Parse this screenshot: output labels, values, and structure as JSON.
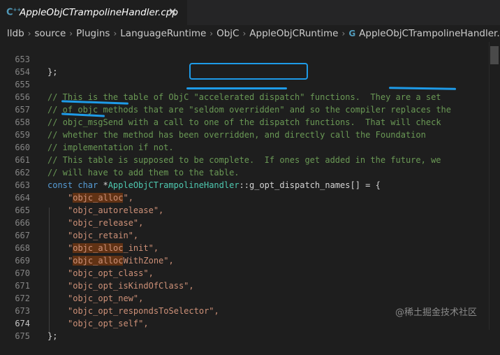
{
  "tab": {
    "icon": "C++",
    "title": "AppleObjCTrampolineHandler.cpp",
    "close": "✕"
  },
  "breadcrumb": [
    "lldb",
    "source",
    "Plugins",
    "LanguageRuntime",
    "ObjC",
    "AppleObjCRuntime",
    "AppleObjCTrampolineHandler.cpp"
  ],
  "breadcrumb_file_icon": "C++",
  "editor": {
    "active_line": "674",
    "lines": [
      {
        "num": "653",
        "c0": "};"
      },
      {
        "num": "654"
      },
      {
        "num": "655",
        "c0": "// This is the table of ObjC ",
        "c1": "\"accelerated dispatch\"",
        "c2": " functions.  They are a set"
      },
      {
        "num": "656",
        "c0": "// of objc methods that are ",
        "c1": "\"seldom overridden\"",
        "c2": " and so the compiler ",
        "c3": "replaces the"
      },
      {
        "num": "657",
        "c0": "// ",
        "c1": "objc_msgSend",
        "c2": " with a call to one of the dispatch functions.  That will check"
      },
      {
        "num": "658",
        "c0": "// ",
        "c1": "whether the method has been overridden, and directly call the Foundation"
      },
      {
        "num": "659",
        "c0": "// implementation if not."
      },
      {
        "num": "660",
        "c0": "// This table is supposed to be complete.  If ones get added in the future, we"
      },
      {
        "num": "661",
        "c0": "// will have to add them to the table."
      },
      {
        "num": "662",
        "kw": "const char",
        "pl1": " *",
        "type": "AppleObjCTrampolineHandler",
        "pl2": "::g_opt_dispatch_names[] = {"
      },
      {
        "num": "663",
        "q": "\"",
        "h": "objc_alloc",
        "r": "\","
      },
      {
        "num": "664",
        "s": "\"objc_autorelease\","
      },
      {
        "num": "665",
        "s": "\"objc_release\","
      },
      {
        "num": "666",
        "s": "\"objc_retain\","
      },
      {
        "num": "667",
        "q": "\"",
        "h": "objc_alloc",
        "r": "_init\","
      },
      {
        "num": "668",
        "q": "\"",
        "h": "objc_alloc",
        "r": "WithZone\","
      },
      {
        "num": "669",
        "s": "\"objc_opt_class\","
      },
      {
        "num": "670",
        "s": "\"objc_opt_isKindOfClass\","
      },
      {
        "num": "671",
        "s": "\"objc_opt_new\","
      },
      {
        "num": "672",
        "s": "\"objc_opt_respondsToSelector\","
      },
      {
        "num": "673",
        "s": "\"objc_opt_self\","
      },
      {
        "num": "674",
        "c0": "};"
      },
      {
        "num": "675"
      }
    ]
  },
  "watermark": "@稀土掘金技术社区",
  "colors": {
    "annotation": "#1e9be8",
    "comment": "#6a9955",
    "string": "#ce9178",
    "keyword": "#569cd6",
    "type": "#4ec9b0",
    "highlight": "#613214"
  }
}
